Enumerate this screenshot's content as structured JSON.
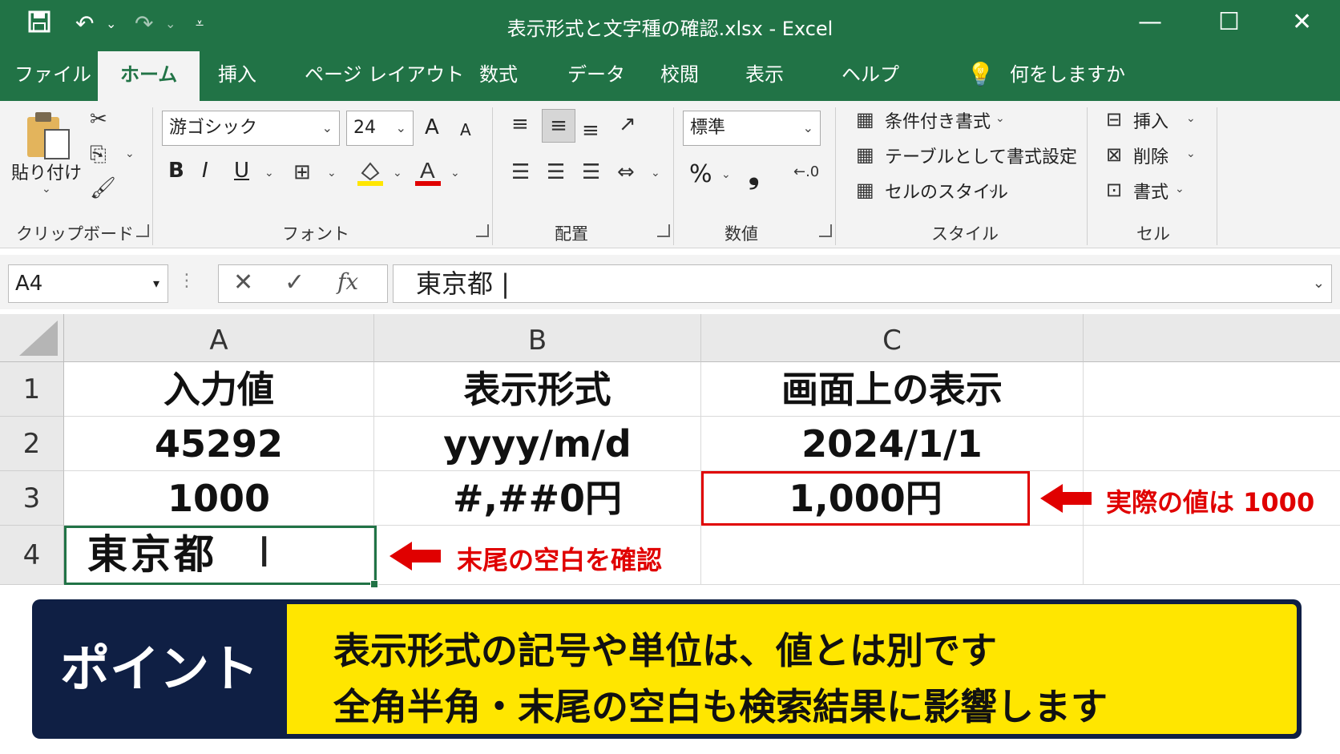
{
  "titlebar": {
    "title": "表示形式と文字種の確認.xlsx  -  Excel",
    "save_icon": "save-icon",
    "undo_icon": "undo-icon",
    "redo_icon": "redo-icon"
  },
  "tabs": [
    "ファイル",
    "ホーム",
    "挿入",
    "ページ レイアウト",
    "数式",
    "データ",
    "校閲",
    "表示",
    "ヘルプ"
  ],
  "tell_me": "何をしますか",
  "ribbon": {
    "clipboard": {
      "paste": "貼り付け",
      "label": "クリップボード"
    },
    "font": {
      "name": "游ゴシック",
      "size": "24",
      "label": "フォント",
      "bold": "B",
      "italic": "I",
      "underline": "U",
      "grow": "A",
      "shrink": "A"
    },
    "alignment": {
      "label": "配置"
    },
    "number": {
      "format": "標準",
      "percent": "%",
      "comma": "❟",
      "label": "数値"
    },
    "styles": {
      "conditional": "条件付き書式",
      "as_table": "テーブルとして書式設定",
      "cell_styles": "セルのスタイル",
      "label": "スタイル"
    },
    "cells": {
      "insert": "挿入",
      "delete": "削除",
      "format": "書式",
      "label": "セル"
    }
  },
  "formula_bar": {
    "name_box": "A4",
    "content": "東京都 |",
    "fx": "fx"
  },
  "sheet": {
    "columns": [
      "A",
      "B",
      "C"
    ],
    "rows": [
      {
        "num": "1",
        "a": "入力値",
        "b": "表示形式",
        "c": "画面上の表示"
      },
      {
        "num": "2",
        "a": "45292",
        "b": "yyyy/m/d",
        "c": "2024/1/1"
      },
      {
        "num": "3",
        "a": "1000",
        "b": "#,##0円",
        "c": "1,000円"
      },
      {
        "num": "4",
        "a": "東京都",
        "b": "",
        "c": ""
      }
    ]
  },
  "annotations": {
    "c3_note": "実際の値は 1000",
    "a4_note": "末尾の空白を確認"
  },
  "point": {
    "label": "ポイント",
    "line1": "表示形式の記号や単位は、値とは別です",
    "line2": "全角半角・末尾の空白も検索結果に影響します"
  },
  "colors": {
    "excel_green": "#217346",
    "annotation_red": "#e00000",
    "point_navy": "#0f1f44",
    "point_yellow": "#ffe600"
  }
}
